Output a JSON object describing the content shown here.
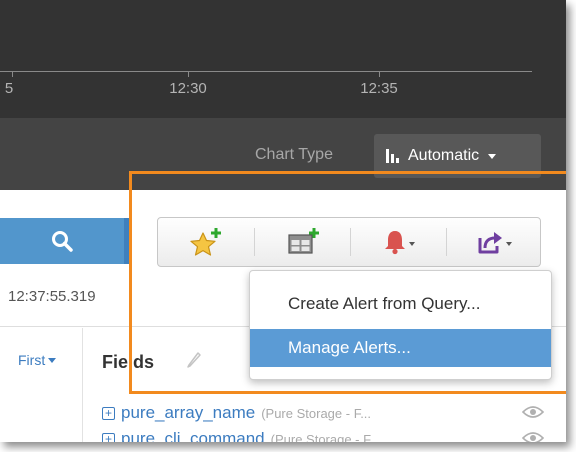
{
  "timeline": {
    "tick_labels": [
      "5",
      "12:30",
      "12:35"
    ]
  },
  "chart_type": {
    "label": "Chart Type",
    "value": "Automatic"
  },
  "search": {
    "icon": "search-icon",
    "timestamp_text": "12:37:55.319"
  },
  "toolbar": {
    "buttons": [
      {
        "name": "add-favorite",
        "icon": "star-plus-icon"
      },
      {
        "name": "add-dashboard-panel",
        "icon": "panel-plus-icon"
      },
      {
        "name": "alerts",
        "icon": "bell-icon"
      },
      {
        "name": "share",
        "icon": "share-icon"
      }
    ]
  },
  "alerts_menu": {
    "items": [
      {
        "label": "Create Alert from Query..."
      },
      {
        "label": "Manage Alerts..."
      }
    ]
  },
  "sort": {
    "label": "First"
  },
  "fields": {
    "title": "Fields",
    "items": [
      {
        "name": "pure_array_name",
        "desc": "(Pure Storage - F..."
      },
      {
        "name": "pure_cli_command",
        "desc": "(Pure Storage - F..."
      }
    ]
  },
  "colors": {
    "highlight": "#f28a1e",
    "search_button": "#5296cc",
    "menu_active": "#5b9bd5",
    "bell": "#d9534f",
    "share": "#6f3fa0",
    "plus": "#2ea82e",
    "star": "#f5c542"
  }
}
